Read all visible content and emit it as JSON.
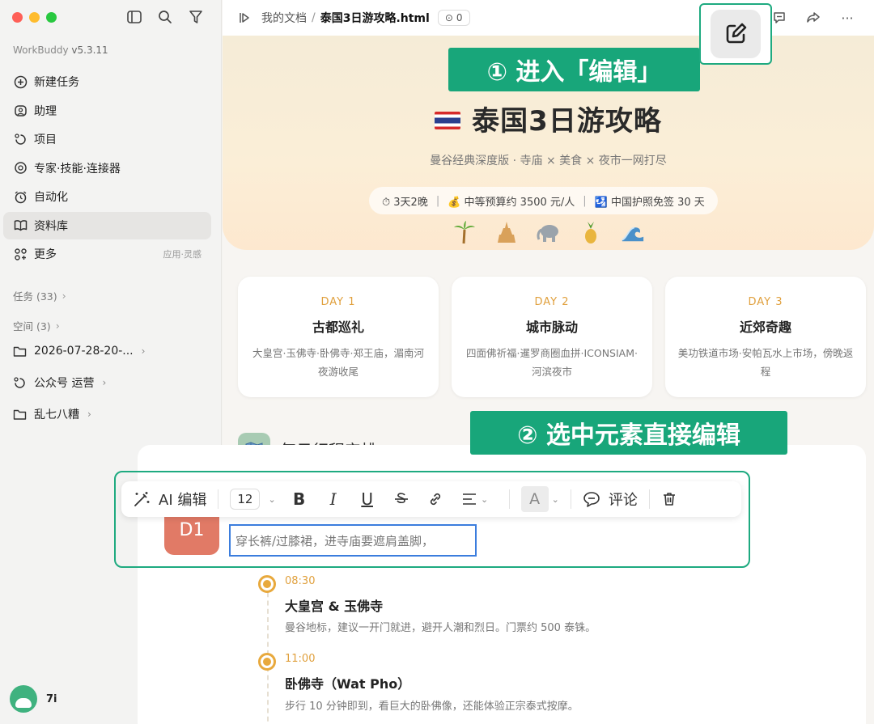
{
  "app": {
    "name": "WorkBuddy",
    "version": "v5.3.11"
  },
  "sidebar": {
    "items": [
      {
        "label": "新建任务",
        "icon": "plus-circle-icon"
      },
      {
        "label": "助理",
        "icon": "assistant-icon"
      },
      {
        "label": "项目",
        "icon": "project-icon"
      },
      {
        "label": "专家·技能·连接器",
        "icon": "expert-icon"
      },
      {
        "label": "自动化",
        "icon": "alarm-icon"
      },
      {
        "label": "资料库",
        "icon": "book-icon",
        "active": true
      },
      {
        "label": "更多",
        "icon": "grid-icon",
        "aside": "应用·灵感"
      }
    ],
    "tasks_label": "任务 (33)",
    "spaces_label": "空间 (3)",
    "folders": [
      "2026-07-28-20-...",
      "公众号 运营",
      "乱七八糟"
    ],
    "user": "7i"
  },
  "topbar": {
    "crumb_root": "我的文档",
    "crumb_sep": "/",
    "file": "泰国3日游攻略.html",
    "comment_count": "0"
  },
  "callouts": {
    "one": "① 进入「编辑」",
    "two": "② 选中元素直接编辑"
  },
  "hero": {
    "title": "泰国3日游攻略",
    "subtitle": "曼谷经典深度版 · 寺庙 × 美食 × 夜市一网打尽",
    "pill_1": "⏱ 3天2晚",
    "pill_2": "💰 中等预算约 3500 元/人",
    "pill_3": "🛂 中国护照免签 30 天",
    "emojis": [
      "🌴",
      "🛕",
      "🐘",
      "🍍",
      "🌊"
    ]
  },
  "days": [
    {
      "label": "DAY 1",
      "title": "古都巡礼",
      "desc": "大皇宫·玉佛寺·卧佛寺·郑王庙，湄南河夜游收尾"
    },
    {
      "label": "DAY 2",
      "title": "城市脉动",
      "desc": "四面佛祈福·暹罗商圈血拼·ICONSIAM·河滨夜市"
    },
    {
      "label": "DAY 3",
      "title": "近郊奇趣",
      "desc": "美功铁道市场·安帕瓦水上市场，傍晚返程"
    }
  ],
  "schedule": {
    "title": "每日行程安排",
    "day_badge": "D1"
  },
  "toolbar": {
    "ai_edit": "AI 编辑",
    "font_size": "12",
    "bold": "B",
    "italic": "I",
    "underline": "U",
    "color": "A",
    "comment": "评论"
  },
  "selected_text": "穿长裤/过膝裙，进寺庙要遮肩盖脚，",
  "timeline": [
    {
      "time": "08:30",
      "title": "大皇宫 & 玉佛寺",
      "desc": "曼谷地标，建议一开门就进，避开人潮和烈日。门票约 500 泰铢。"
    },
    {
      "time": "11:00",
      "title": "卧佛寺（Wat Pho）",
      "desc": "步行 10 分钟即到，看巨大的卧佛像，还能体验正宗泰式按摩。"
    }
  ],
  "colors": {
    "accent": "#18a67a",
    "orange": "#e0a03d",
    "select_blue": "#3b7ddd"
  }
}
